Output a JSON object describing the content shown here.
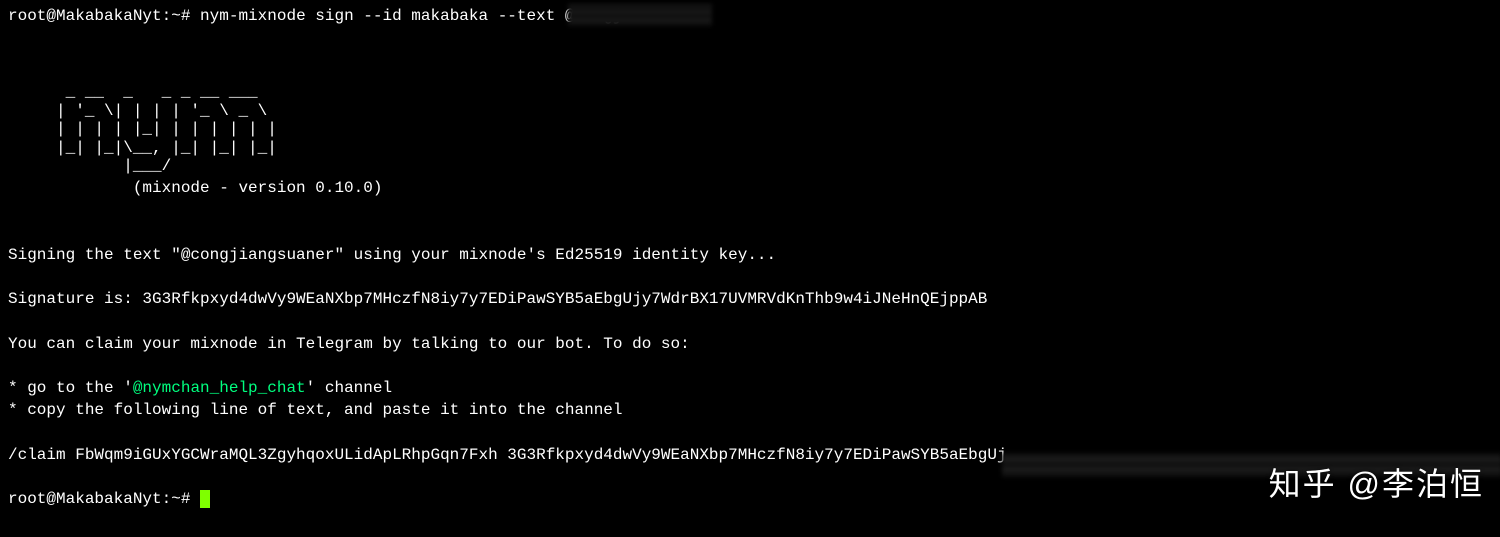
{
  "prompt1": {
    "user_host": "root@MakabakaNyt",
    "path": ":~#",
    "command": "nym-mixnode sign --id makabaka --text @congj"
  },
  "ascii_art": "      _ __  _   _ _ __ ___\n     | '_ \\| | | | '_ \\ _ \\\n     | | | | |_| | | | | | |\n     |_| |_|\\__, |_| |_| |_|\n            |___/",
  "version_line": "             (mixnode - version 0.10.0)",
  "signing_line": "Signing the text \"@congjiangsuaner\" using your mixnode's Ed25519 identity key...",
  "signature_line": "Signature is: 3G3Rfkpxyd4dwVy9WEaNXbp7MHczfN8iy7y7EDiPawSYB5aEbgUjy7WdrBX17UVMRVdKnThb9w4iJNeHnQEjppAB",
  "claim_intro": "You can claim your mixnode in Telegram by talking to our bot. To do so:",
  "bullet1_pre": "* go to the '",
  "bullet1_hl": "@nymchan_help_chat",
  "bullet1_post": "' channel",
  "bullet2": "* copy the following line of text, and paste it into the channel",
  "claim_line": "/claim FbWqm9iGUxYGCWraMQL3ZgyhqoxULidApLRhpGqn7Fxh 3G3Rfkpxyd4dwVy9WEaNXbp7MHczfN8iy7y7EDiPawSYB5aEbgUj",
  "prompt2": {
    "user_host": "root@MakabakaNyt",
    "path": ":~# "
  },
  "watermark": "知乎 @李泊恒"
}
